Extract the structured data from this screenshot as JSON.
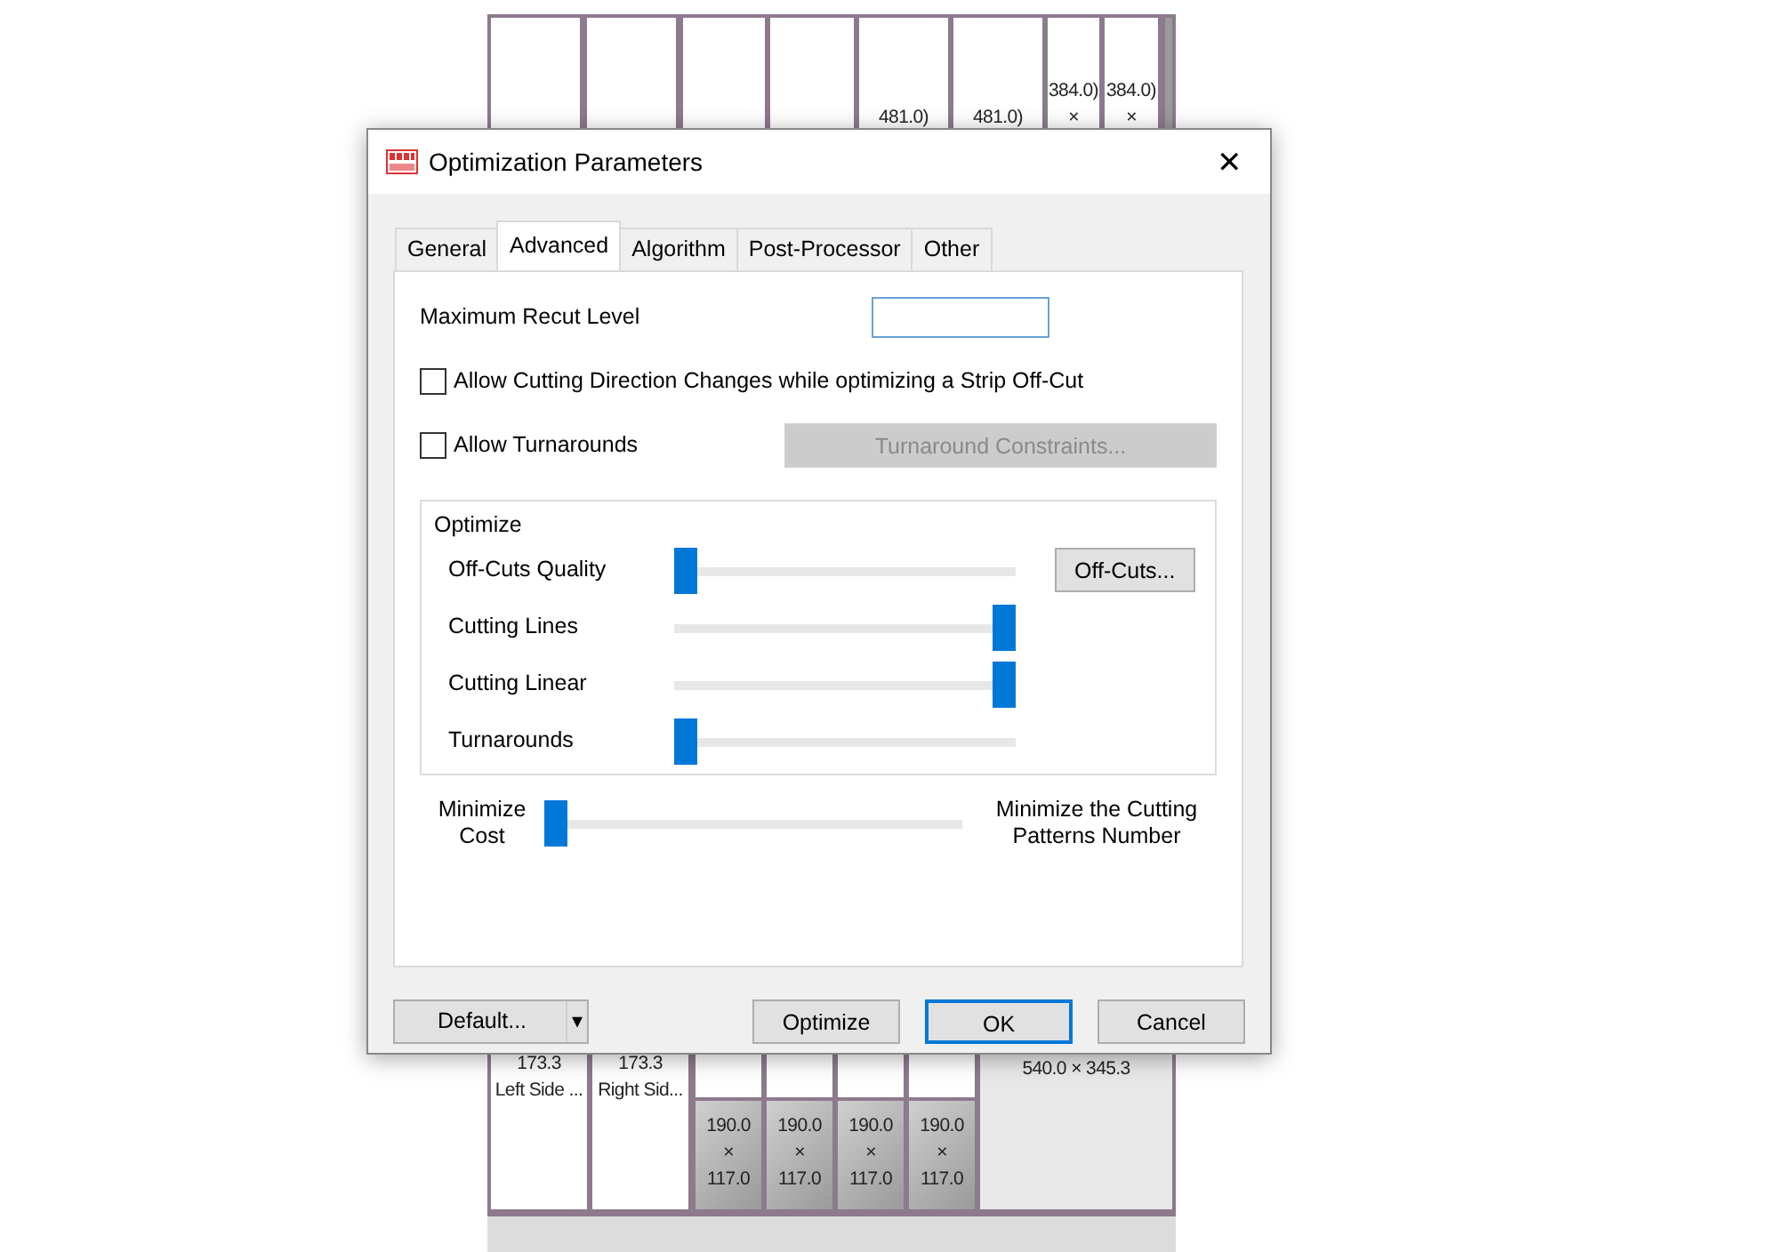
{
  "background_layout": {
    "top_panels": [
      {
        "lines": [
          "481.0)"
        ]
      },
      {
        "lines": [
          "481.0)"
        ]
      },
      {
        "lines": [
          "384.0)",
          "×"
        ]
      },
      {
        "lines": [
          "384.0)",
          "×"
        ]
      }
    ],
    "bottom_panels": [
      {
        "kind": "side",
        "lines": [
          "173.3",
          "Left Side ..."
        ]
      },
      {
        "kind": "side",
        "lines": [
          "173.3",
          "Right Sid..."
        ]
      },
      {
        "kind": "part",
        "lines": [
          "190.0",
          "×",
          "117.0"
        ]
      },
      {
        "kind": "part",
        "lines": [
          "190.0",
          "×",
          "117.0"
        ]
      },
      {
        "kind": "part",
        "lines": [
          "190.0",
          "×",
          "117.0"
        ]
      },
      {
        "kind": "part",
        "lines": [
          "190.0",
          "×",
          "117.0"
        ]
      },
      {
        "kind": "offcut",
        "lines": [
          "540.0 × 345.3"
        ]
      }
    ]
  },
  "window": {
    "title": "Optimization Parameters",
    "close": "✕"
  },
  "tabs": [
    {
      "label": "General",
      "selected": false
    },
    {
      "label": "Advanced",
      "selected": true
    },
    {
      "label": "Algorithm",
      "selected": false
    },
    {
      "label": "Post-Processor",
      "selected": false
    },
    {
      "label": "Other",
      "selected": false
    }
  ],
  "recut": {
    "label": "Maximum Recut Level"
  },
  "options": [
    {
      "label": "Allow Cutting Direction Changes while optimizing a Strip Off-Cut",
      "checked": false
    },
    {
      "label": "Allow Turnarounds",
      "checked": false,
      "button": {
        "label": "Turnaround Constraints...",
        "disabled": true
      }
    }
  ],
  "optimize_group": {
    "title": "Optimize",
    "sliders": [
      {
        "label": "Off-Cuts Quality",
        "level": 0,
        "button": "Off-Cuts..."
      },
      {
        "label": "Cutting Lines",
        "level": 1
      },
      {
        "label": "Cutting Linear",
        "level": 1
      },
      {
        "label": "Turnarounds",
        "level": 0
      }
    ]
  },
  "balance": {
    "left": "Minimize Cost",
    "right": "Minimize the Cutting Patterns Number",
    "level": 0
  },
  "footer_buttons": [
    {
      "kind": "split",
      "label": "Default...",
      "caret": "▾",
      "default": false
    },
    {
      "kind": "plain",
      "label": "Optimize",
      "default": false
    },
    {
      "kind": "plain",
      "label": "OK",
      "default": true
    },
    {
      "kind": "plain",
      "label": "Cancel",
      "default": false
    }
  ]
}
